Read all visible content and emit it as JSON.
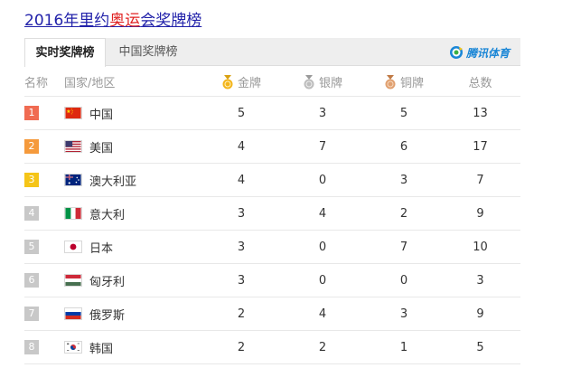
{
  "title": {
    "year": "2016年",
    "pre": "里约",
    "highlight": "奥运",
    "post": "会奖牌榜"
  },
  "tabs": [
    {
      "label": "实时奖牌榜",
      "active": true
    },
    {
      "label": "中国奖牌榜",
      "active": false
    }
  ],
  "brand": {
    "text": "腾讯体育",
    "icon": "tencent-sports-logo-icon"
  },
  "headers": {
    "rank": "名称",
    "country": "国家/地区",
    "gold": "金牌",
    "silver": "银牌",
    "bronze": "铜牌",
    "total": "总数"
  },
  "colors": {
    "rank1": "#f06b52",
    "rank2": "#f59a3c",
    "rank3": "#f5c518",
    "rank_other": "#c8c8c8",
    "gold": "#f3b51b",
    "silver": "#b8b8b8",
    "bronze": "#e0a070"
  },
  "rows": [
    {
      "rank": "1",
      "country": "中国",
      "flag": "china-flag-icon",
      "gold": "5",
      "silver": "3",
      "bronze": "5",
      "total": "13"
    },
    {
      "rank": "2",
      "country": "美国",
      "flag": "usa-flag-icon",
      "gold": "4",
      "silver": "7",
      "bronze": "6",
      "total": "17"
    },
    {
      "rank": "3",
      "country": "澳大利亚",
      "flag": "australia-flag-icon",
      "gold": "4",
      "silver": "0",
      "bronze": "3",
      "total": "7"
    },
    {
      "rank": "4",
      "country": "意大利",
      "flag": "italy-flag-icon",
      "gold": "3",
      "silver": "4",
      "bronze": "2",
      "total": "9"
    },
    {
      "rank": "5",
      "country": "日本",
      "flag": "japan-flag-icon",
      "gold": "3",
      "silver": "0",
      "bronze": "7",
      "total": "10"
    },
    {
      "rank": "6",
      "country": "匈牙利",
      "flag": "hungary-flag-icon",
      "gold": "3",
      "silver": "0",
      "bronze": "0",
      "total": "3"
    },
    {
      "rank": "7",
      "country": "俄罗斯",
      "flag": "russia-flag-icon",
      "gold": "2",
      "silver": "4",
      "bronze": "3",
      "total": "9"
    },
    {
      "rank": "8",
      "country": "韩国",
      "flag": "korea-flag-icon",
      "gold": "2",
      "silver": "2",
      "bronze": "1",
      "total": "5"
    }
  ]
}
